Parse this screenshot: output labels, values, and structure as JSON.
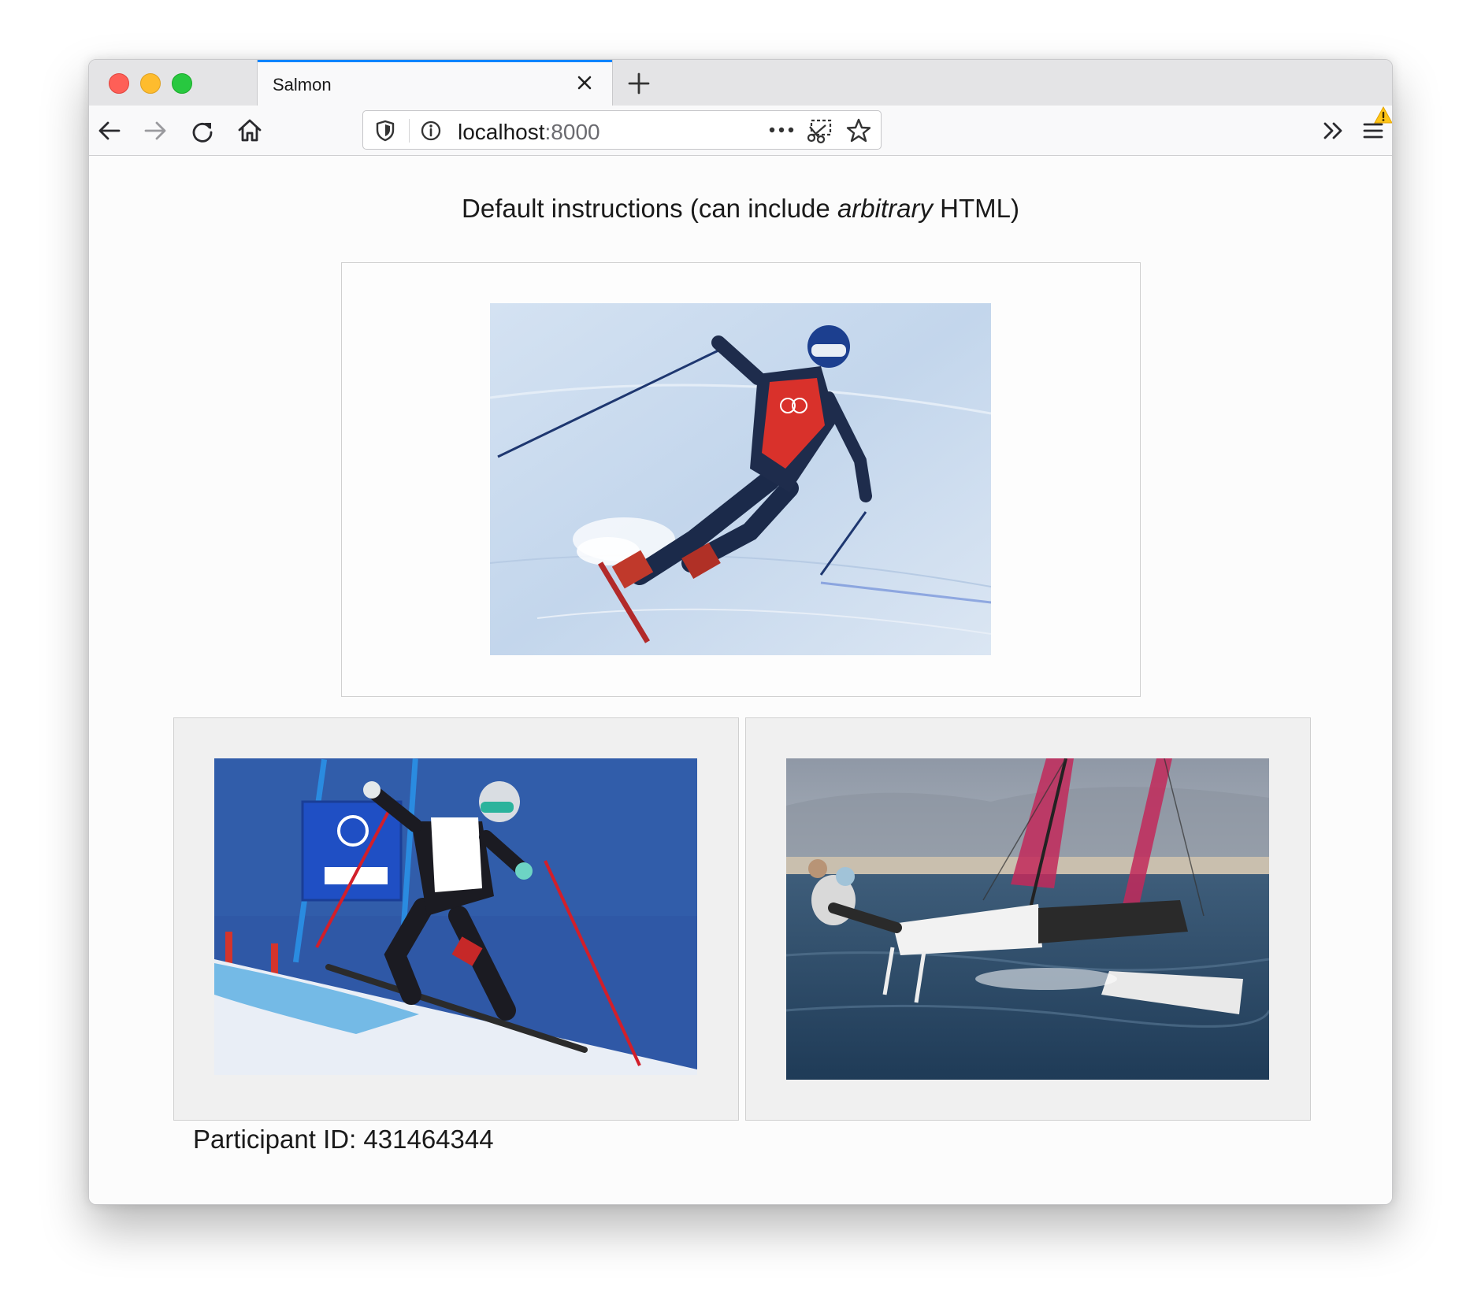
{
  "browser": {
    "tab_title": "Salmon",
    "url_host": "localhost",
    "url_port": ":8000",
    "icons": [
      "close-icon",
      "plus-icon",
      "back-icon",
      "forward-icon",
      "reload-icon",
      "home-icon",
      "shield-icon",
      "info-icon",
      "more-icon",
      "screenshot-icon",
      "star-icon",
      "overflow-icon",
      "menu-icon",
      "warning-icon"
    ]
  },
  "page": {
    "instructions_before": "Default instructions (can include ",
    "instructions_em": "arbitrary",
    "instructions_after": " HTML)",
    "participant_label": "Participant ID:",
    "participant_id": "431464344"
  },
  "images": {
    "top": "downhill skier in red bib on snow",
    "bottom_left": "giant slalom skier passing blue gate",
    "bottom_right": "hydrofoil catamaran sailing on water"
  },
  "colors": {
    "accent": "#0a84ff",
    "traffic_red": "#fe5f57",
    "traffic_yellow": "#febc2e",
    "traffic_green": "#28c840"
  }
}
